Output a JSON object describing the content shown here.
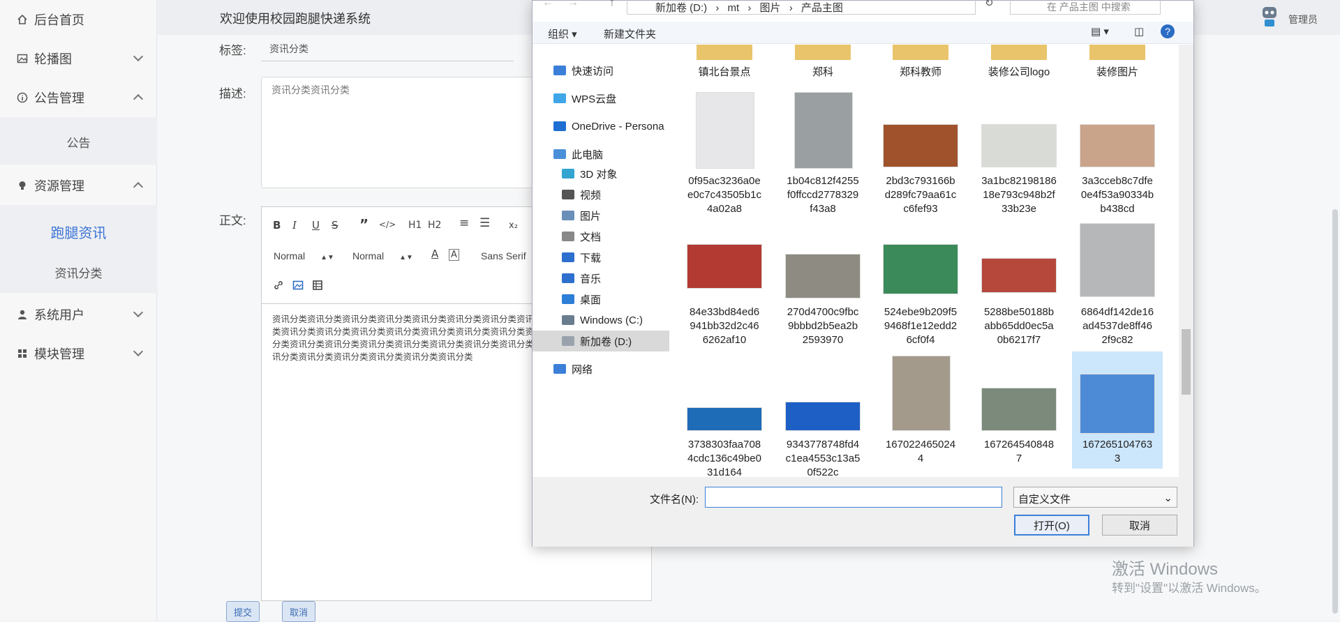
{
  "sidebar": {
    "items": [
      {
        "label": "后台首页",
        "icon": "home-icon"
      },
      {
        "label": "轮播图",
        "icon": "image-icon"
      },
      {
        "label": "公告管理",
        "icon": "info-icon"
      },
      {
        "label": "公告"
      },
      {
        "label": "资源管理",
        "icon": "bulb-icon"
      },
      {
        "label": "跑腿资讯"
      },
      {
        "label": "资讯分类"
      },
      {
        "label": "系统用户",
        "icon": "user-icon"
      },
      {
        "label": "模块管理",
        "icon": "grid-icon"
      }
    ]
  },
  "topbar": {
    "welcome": "欢迎使用校园跑腿快递系统",
    "admin": "管理员"
  },
  "form": {
    "tag_label": "标签:",
    "tag_value": "资讯分类",
    "desc_label": "描述:",
    "desc_value": "资讯分类资讯分类",
    "body_label": "正文:",
    "editor_body": "资讯分类资讯分类资讯分类资讯分类资讯分类资讯分类资讯分类资讯分类资讯分类资讯分类资讯分类资讯分类资讯分类资讯分类资讯分类资讯分类资讯分类资讯分类资讯分类资讯分类资讯分类资讯分类资讯分类资讯分类资讯分类资讯分类资讯分类资讯分类资讯分类资讯分类资讯分类资讯分类资讯分类资讯分类资讯分类资讯分类资讯分类资讯分类",
    "submit": "提交",
    "cancel": "取消"
  },
  "editor": {
    "header1": "H1",
    "header2": "H2",
    "sub": "x₂",
    "size": "Normal",
    "heading": "Normal",
    "font": "Sans Serif"
  },
  "dialog": {
    "path": [
      "新加卷 (D:)",
      "mt",
      "图片",
      "产品主图"
    ],
    "search_placeholder": "在 产品主图 中搜索",
    "organize": "组织",
    "new_folder": "新建文件夹",
    "help": "?",
    "nav": [
      {
        "label": "快速访问",
        "color": "#3c7fd9"
      },
      {
        "label": "WPS云盘",
        "color": "#3fa6e8"
      },
      {
        "label": "OneDrive - Persona",
        "color": "#1f6fd1"
      },
      {
        "label": "此电脑",
        "color": "#4a90d9"
      },
      {
        "label": "3D 对象",
        "color": "#34a4d0"
      },
      {
        "label": "视频",
        "color": "#555"
      },
      {
        "label": "图片",
        "color": "#6a8fb8"
      },
      {
        "label": "文档",
        "color": "#888"
      },
      {
        "label": "下载",
        "color": "#2d6fce"
      },
      {
        "label": "音乐",
        "color": "#2d6fce"
      },
      {
        "label": "桌面",
        "color": "#2d7ed6"
      },
      {
        "label": "Windows (C:)",
        "color": "#6a7d8e"
      },
      {
        "label": "新加卷 (D:)",
        "color": "#9aa3ad"
      },
      {
        "label": "网络",
        "color": "#3c7fd9"
      }
    ],
    "files_row0": [
      "镇北台景点",
      "郑科",
      "郑科教师",
      "装修公司logo",
      "装修图片"
    ],
    "files_row1": [
      [
        "0f95ac3236a0e",
        "e0c7c43505b1c",
        "4a02a8"
      ],
      [
        "1b04c812f4255",
        "f0ffccd2778329",
        "f43a8"
      ],
      [
        "2bd3c793166b",
        "d289fc79aa61c",
        "c6fef93"
      ],
      [
        "3a1bc82198186",
        "18e793c948b2f",
        "33b23e"
      ],
      [
        "3a3cceb8c7dfe",
        "0e4f53a90334b",
        "b438cd"
      ]
    ],
    "files_row2": [
      [
        "84e33bd84ed6",
        "941bb32d2c46",
        "6262af10"
      ],
      [
        "270d4700c9fbc",
        "9bbbd2b5ea2b",
        "2593970"
      ],
      [
        "524ebe9b209f5",
        "9468f1e12edd2",
        "6cf0f4"
      ],
      [
        "5288be50188b",
        "abb65dd0ec5a",
        "0b6217f7"
      ],
      [
        "6864df142de16",
        "ad4537de8ff46",
        "2f9c82"
      ]
    ],
    "files_row3": [
      [
        "3738303faa708",
        "4cdc136c49be0",
        "31d164"
      ],
      [
        "9343778748fd4",
        "c1ea4553c13a5",
        "0f522c"
      ],
      [
        "167022465024",
        "4"
      ],
      [
        "167264540848",
        "7"
      ],
      [
        "167265104763",
        "3"
      ]
    ],
    "filename_label": "文件名(N):",
    "filename_value": "",
    "filetype": "自定义文件",
    "open": "打开(O)",
    "cancel": "取消"
  },
  "watermark": {
    "line1": "激活 Windows",
    "line2": "转到\"设置\"以激活 Windows。"
  }
}
